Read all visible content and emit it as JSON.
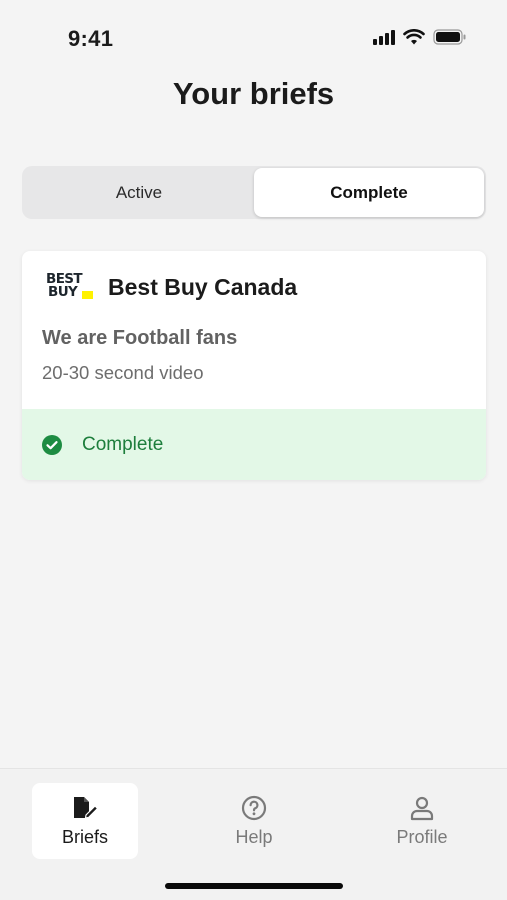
{
  "status_bar": {
    "time": "9:41"
  },
  "page": {
    "title": "Your briefs"
  },
  "segments": {
    "active_label": "Active",
    "complete_label": "Complete",
    "selected": "Complete"
  },
  "brief": {
    "logo_line1": "BEST",
    "logo_line2": "BUY",
    "brand": "Best Buy Canada",
    "title": "We are Football fans",
    "subtitle": "20-30 second video",
    "status": "Complete"
  },
  "tabs": [
    {
      "label": "Briefs",
      "icon": "briefs-icon",
      "selected": true
    },
    {
      "label": "Help",
      "icon": "help-icon",
      "selected": false
    },
    {
      "label": "Profile",
      "icon": "profile-icon",
      "selected": false
    }
  ],
  "colors": {
    "status_bg": "#e3f8e7",
    "status_text": "#1d7e3c",
    "brand_yellow": "#fff200",
    "background": "#f4f4f4"
  }
}
